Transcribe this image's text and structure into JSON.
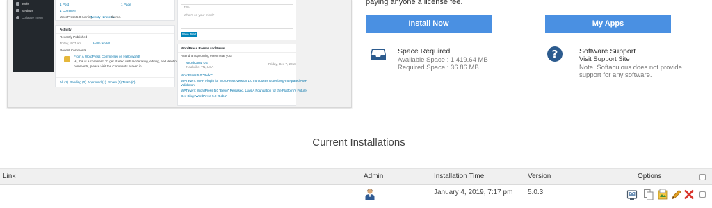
{
  "preview": {
    "sidebar": [
      "Tools",
      "Settings",
      "Collapse menu"
    ],
    "at_glance": {
      "post_count": "1 Post",
      "page_count": "1 Page",
      "comment_count": "1 Comment",
      "running_text": "WordPress 5.0 running",
      "theme_link": "Twenty Nineteen",
      "theme_suffix": "theme."
    },
    "activity": {
      "title": "Activity",
      "recently_published": "Recently Published",
      "published_time": "Today, 4:07 am",
      "published_post": "Hello world!",
      "recent_comments": "Recent Comments",
      "comment_from": "From A WordPress Commenter on Hello world!",
      "comment_text_1": "Hi, this is a comment. To get started with moderating, editing, and deleting",
      "comment_text_2": "comments, please visit the Comments screen in...",
      "filters": [
        "All (1)",
        "Pending (0)",
        "Approved (1)",
        "Spam (0)",
        "Trash (0)"
      ]
    },
    "quick_draft": {
      "title_placeholder": "Title",
      "content_placeholder": "What's on your mind?",
      "save_button": "Save Draft"
    },
    "events": {
      "title": "WordPress Events and News",
      "attend_text": "Attend an upcoming event near you.",
      "event_name": "WordCamp US",
      "event_location": "Nashville, TN, USA",
      "event_date": "Friday, Dec 7, 2018",
      "news": [
        "WordPress 5.0 \"Bebo\"",
        "WPTavern: WAP Plugin for WordPress Version 1.0 Introduces Gutenberg-Integrated AMP",
        "Validation",
        "WPTavern: WordPress 5.0 \"Bebo\" Released, Lays A Foundation for the Platform's Future",
        "Dev Blog: WordPress 5.0 \"Bebo\""
      ]
    }
  },
  "license_text": "paying anyone a license fee.",
  "buttons": {
    "install": "Install Now",
    "my_apps": "My Apps"
  },
  "space": {
    "title": "Space Required",
    "available": "Available Space : 1,419.64 MB",
    "required": "Required Space : 36.86 MB"
  },
  "support": {
    "title": "Software Support",
    "link": "Visit Support Site",
    "note_1": "Note: Softaculous does not provide",
    "note_2": "support for any software."
  },
  "installations": {
    "heading": "Current Installations",
    "columns": {
      "link": "Link",
      "admin": "Admin",
      "time": "Installation Time",
      "version": "Version",
      "options": "Options"
    },
    "rows": [
      {
        "time": "January 4, 2019, 7:17 pm",
        "version": "5.0.3"
      }
    ]
  },
  "colors": {
    "accent_button": "#4a90e2",
    "wp_sidebar": "#23282d",
    "remove_icon": "#d9342b",
    "edit_icon": "#e0a020"
  },
  "icons": [
    "inbox-icon",
    "help-circle-icon",
    "admin-user-icon",
    "backup-icon",
    "clone-icon",
    "staging-icon",
    "edit-icon",
    "remove-icon"
  ]
}
